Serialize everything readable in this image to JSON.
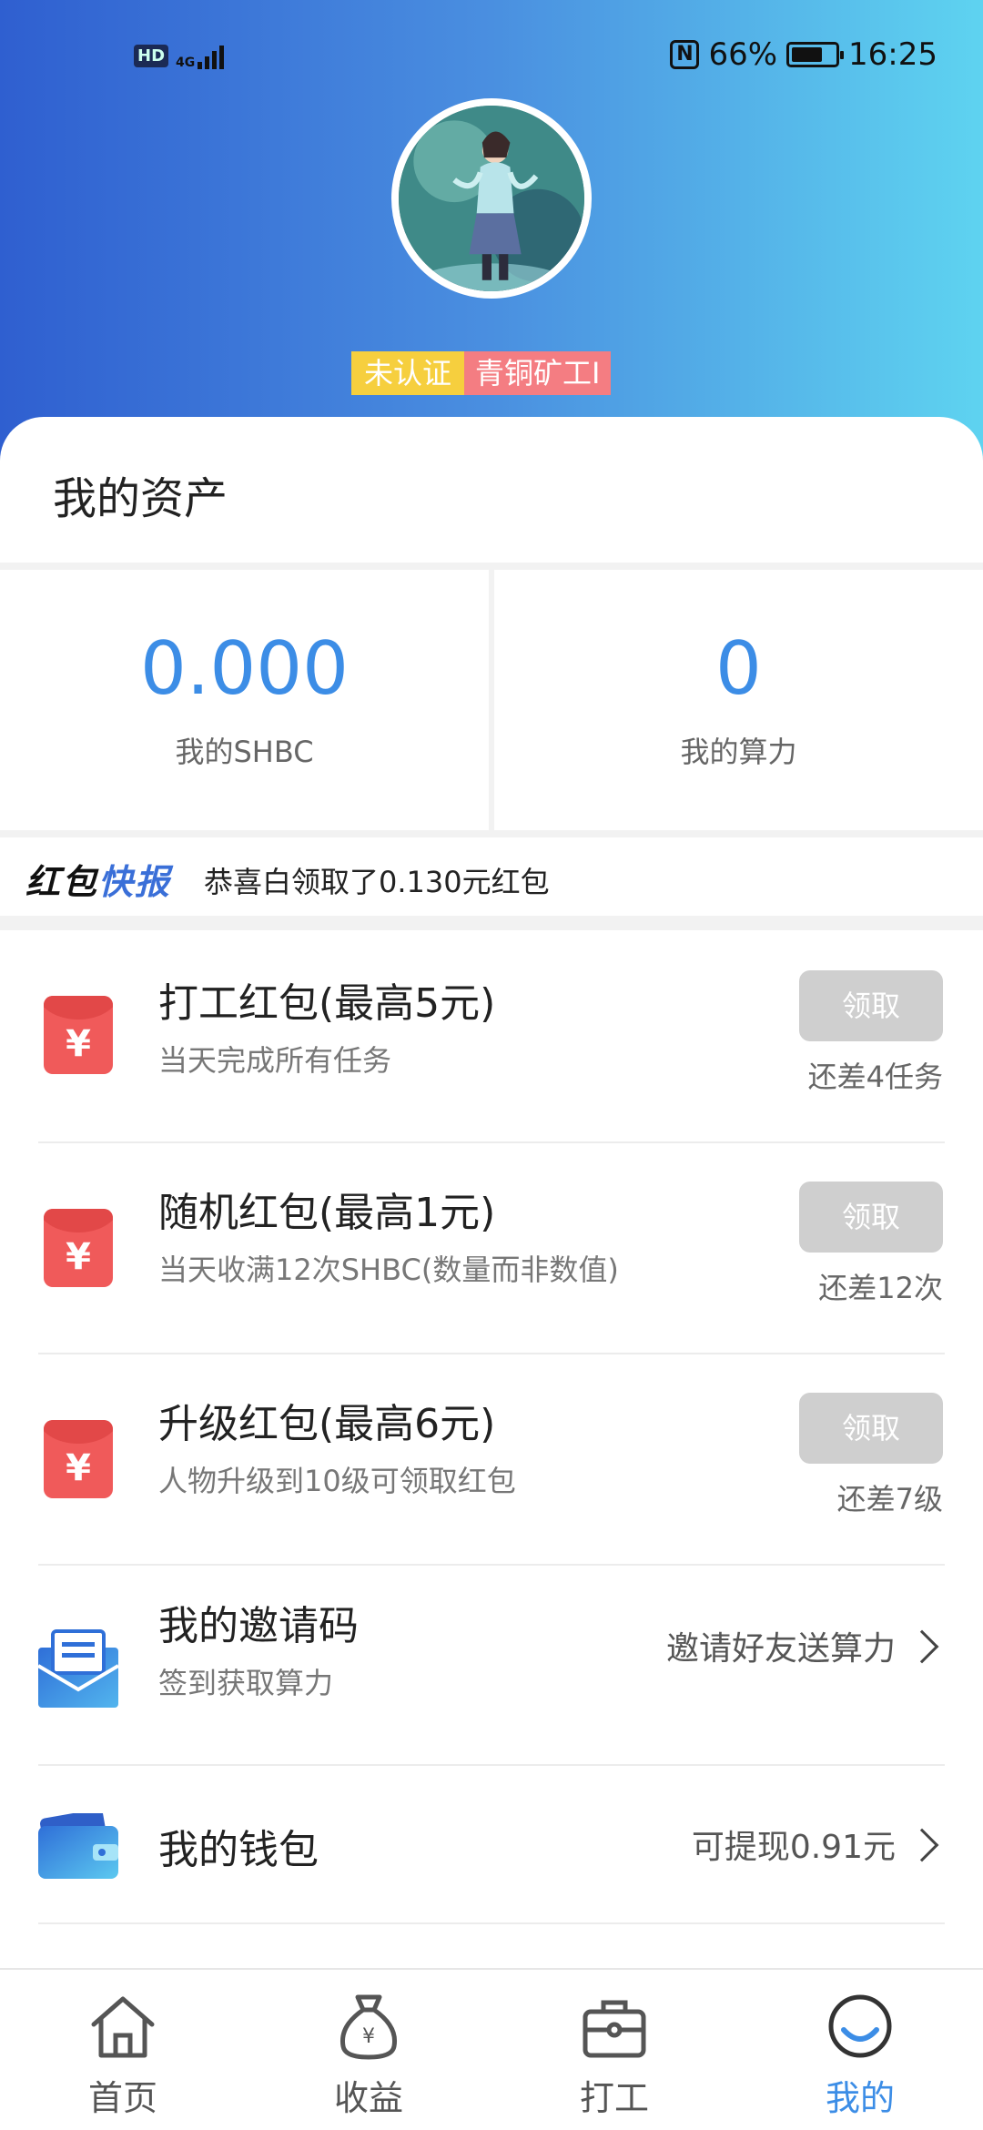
{
  "status_bar": {
    "hd": "HD",
    "network": "4G",
    "nfc": "N",
    "battery": "66%",
    "time": "16:25"
  },
  "profile": {
    "badge_unverified": "未认证",
    "badge_level": "青铜矿工I"
  },
  "assets": {
    "title": "我的资产",
    "shbc_value": "0.000",
    "shbc_label": "我的SHBC",
    "power_value": "0",
    "power_label": "我的算力"
  },
  "news": {
    "logo_part1": "红包",
    "logo_part2": "快报",
    "text": "恭喜白领取了0.130元红包"
  },
  "rewards": [
    {
      "title": "打工红包(最高5元)",
      "subtitle": "当天完成所有任务",
      "button": "领取",
      "remaining": "还差4任务"
    },
    {
      "title": "随机红包(最高1元)",
      "subtitle": "当天收满12次SHBC(数量而非数值)",
      "button": "领取",
      "remaining": "还差12次"
    },
    {
      "title": "升级红包(最高6元)",
      "subtitle": "人物升级到10级可领取红包",
      "button": "领取",
      "remaining": "还差7级"
    }
  ],
  "envelope_symbol": "¥",
  "invite": {
    "title": "我的邀请码",
    "subtitle": "签到获取算力",
    "action": "邀请好友送算力"
  },
  "wallet": {
    "title": "我的钱包",
    "action": "可提现0.91元"
  },
  "tabs": [
    {
      "label": "首页",
      "icon": "home-icon"
    },
    {
      "label": "收益",
      "icon": "money-bag-icon"
    },
    {
      "label": "打工",
      "icon": "briefcase-icon"
    },
    {
      "label": "我的",
      "icon": "profile-smile-icon"
    }
  ],
  "active_tab": "我的",
  "colors": {
    "accent": "#3c8de6",
    "header_gradient_start": "#2f5fd0",
    "header_gradient_end": "#5ed3f0",
    "badge_unverified": "#f6cf3e",
    "badge_level": "#f47d82",
    "envelope_red": "#f05a5a",
    "button_disabled": "#cfcfcf"
  }
}
